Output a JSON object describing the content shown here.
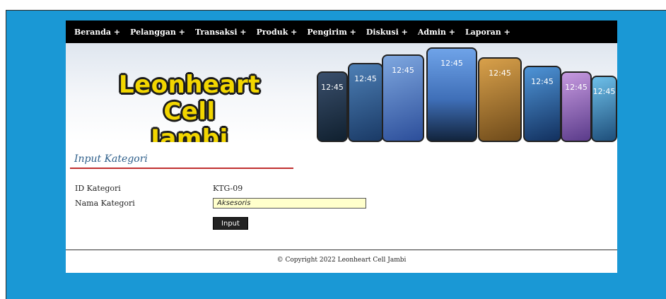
{
  "nav": {
    "items": [
      "Beranda +",
      "Pelanggan +",
      "Transaksi +",
      "Produk +",
      "Pengirim +",
      "Diskusi +",
      "Admin +",
      "Laporan +"
    ]
  },
  "banner": {
    "line1": "Leonheart Cell",
    "line2": "Jambi",
    "clock": "12:45"
  },
  "form": {
    "title": "Input Kategori",
    "id_label": "ID Kategori",
    "id_value": "KTG-09",
    "name_label": "Nama Kategori",
    "name_value": "Aksesoris",
    "submit_label": "Input"
  },
  "footer": {
    "text": "© Copyright 2022 Leonheart Cell Jambi"
  },
  "colors": {
    "background": "#1a98d5",
    "nav": "#000000",
    "title": "#2d5e8a",
    "rule": "#c03030",
    "field": "#ffffcc"
  }
}
